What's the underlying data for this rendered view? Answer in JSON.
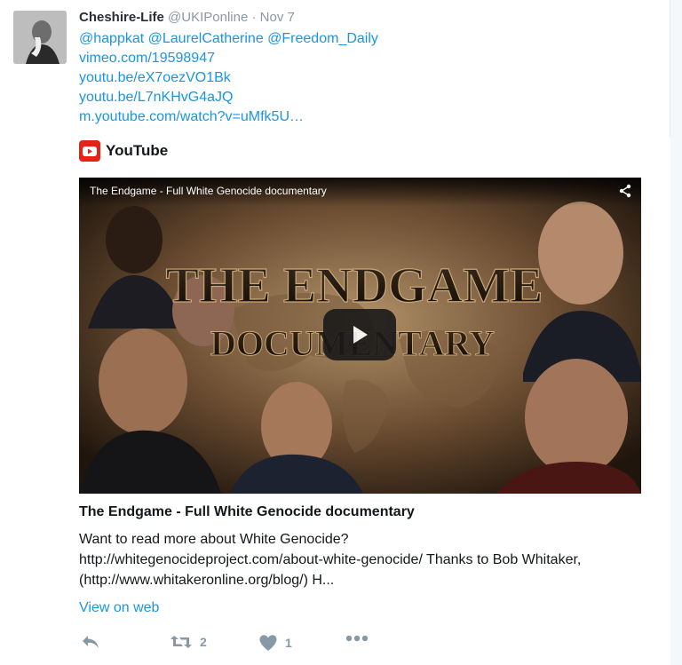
{
  "tweet": {
    "author_name": "Cheshire-Life",
    "author_handle": "@UKIPonline",
    "separator": "·",
    "timestamp": "Nov 7",
    "lines": [
      "@happkat @LaurelCatherine @Freedom_Daily",
      "vimeo.com/19598947",
      "youtu.be/eX7oezVO1Bk",
      "youtu.be/L7nKHvG4aJQ",
      "m.youtube.com/watch?v=uMfk5U…"
    ]
  },
  "card": {
    "source": "YouTube",
    "video_overlay_title": "The Endgame - Full White Genocide documentary",
    "video_art_text": {
      "line1": "THE ENDGAME",
      "line2": "DOCUMENTARY"
    },
    "title": "The Endgame - Full White Genocide documentary",
    "description": [
      "Want to read more about White Genocide?",
      "http://whitegenocideproject.com/about-white-genocide/ Thanks to Bob Whitaker,",
      "(http://www.whitakeronline.org/blog/) H..."
    ],
    "view_on_web": "View on web"
  },
  "actions": {
    "retweet_count": "2",
    "like_count": "1"
  },
  "colors": {
    "link": "#1b95e0",
    "muted": "#8899a6",
    "youtube_red": "#e62117"
  },
  "icons": [
    "reply-icon",
    "retweet-icon",
    "heart-icon",
    "more-icon",
    "share-icon",
    "play-icon",
    "youtube-logo"
  ]
}
